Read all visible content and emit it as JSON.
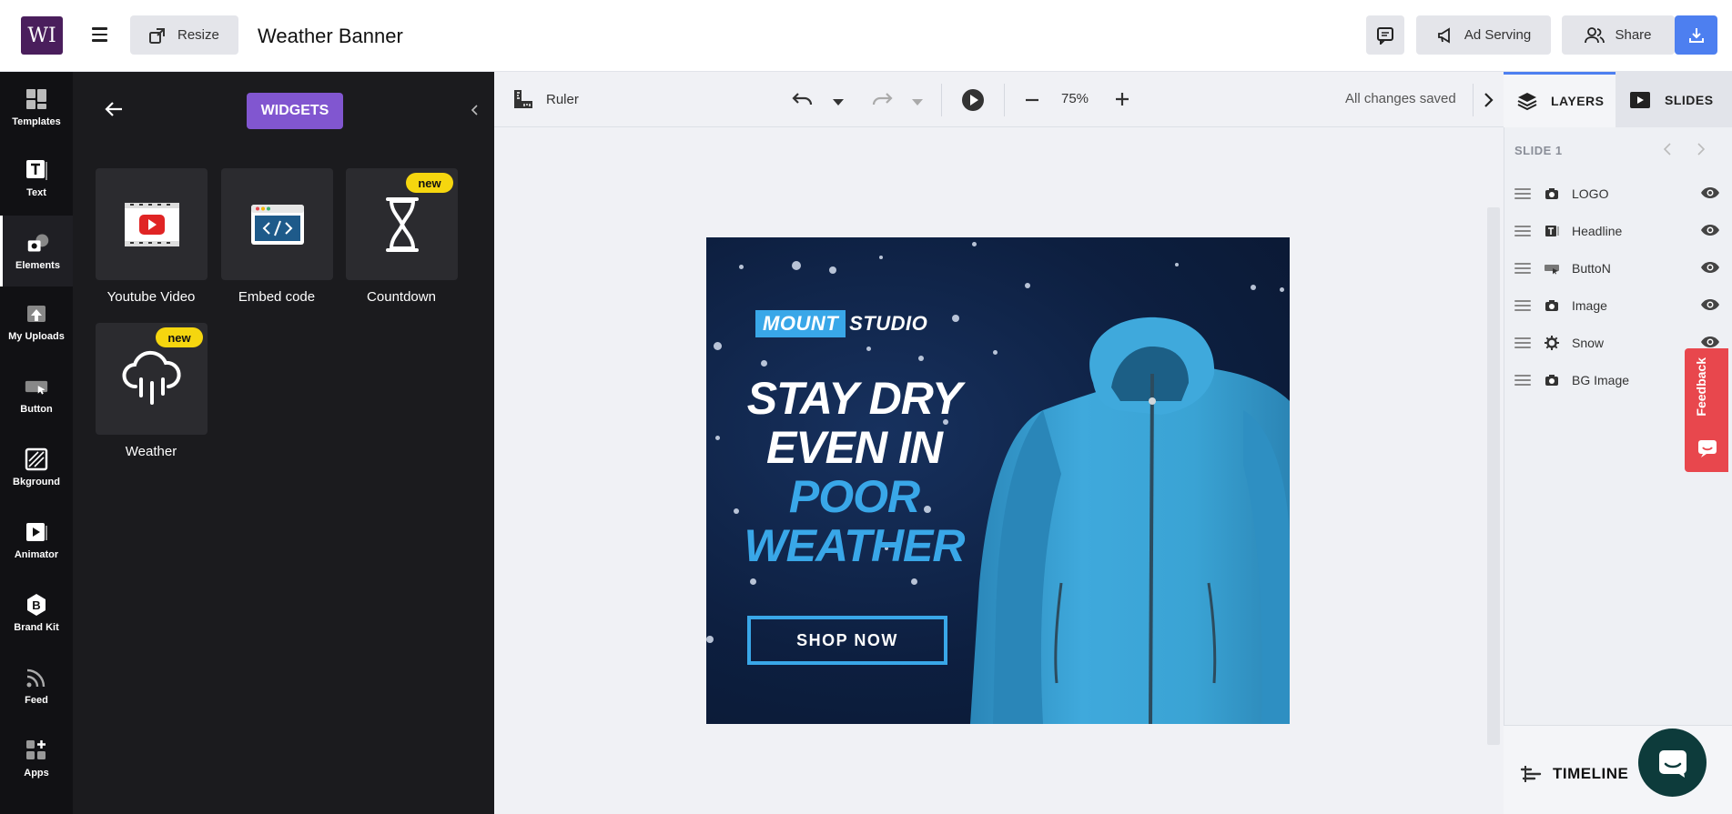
{
  "app": {
    "logo_text": "WI",
    "document_title": "Weather Banner"
  },
  "topbar": {
    "resize_label": "Resize",
    "ad_serving_label": "Ad Serving",
    "share_label": "Share"
  },
  "rail": {
    "items": [
      {
        "label": "Templates",
        "icon": "templates-icon"
      },
      {
        "label": "Text",
        "icon": "text-icon"
      },
      {
        "label": "Elements",
        "icon": "elements-icon"
      },
      {
        "label": "My Uploads",
        "icon": "upload-icon"
      },
      {
        "label": "Button",
        "icon": "button-icon"
      },
      {
        "label": "Bkground",
        "icon": "background-icon"
      },
      {
        "label": "Animator",
        "icon": "animator-icon"
      },
      {
        "label": "Brand Kit",
        "icon": "brand-kit-icon"
      },
      {
        "label": "Feed",
        "icon": "feed-icon"
      },
      {
        "label": "Apps",
        "icon": "apps-icon"
      }
    ],
    "active": "Elements"
  },
  "widgets_panel": {
    "title": "WIDGETS",
    "badge_text": "new",
    "widgets": [
      {
        "label": "Youtube Video",
        "icon": "youtube-icon",
        "is_new": false
      },
      {
        "label": "Embed code",
        "icon": "embed-code-icon",
        "is_new": false
      },
      {
        "label": "Countdown",
        "icon": "countdown-icon",
        "is_new": true
      },
      {
        "label": "Weather",
        "icon": "weather-icon",
        "is_new": true
      }
    ]
  },
  "canvas_toolbar": {
    "ruler_label": "Ruler",
    "zoom": "75%",
    "save_status": "All changes saved"
  },
  "banner": {
    "logo_part1": "MOUNT",
    "logo_part2": "STUDIO",
    "headline_line1": "STAY DRY",
    "headline_line2": "EVEN IN",
    "headline_line3": "POOR",
    "headline_line4": "WEATHER",
    "cta": "SHOP NOW",
    "colors": {
      "accent": "#39a7e8",
      "background": "#0d1f40",
      "jacket": "#3aa3d4"
    }
  },
  "right_panel": {
    "tabs": [
      {
        "label": "LAYERS",
        "active": true
      },
      {
        "label": "SLIDES",
        "active": false
      }
    ],
    "slide_label": "SLIDE 1",
    "layers": [
      {
        "name": "LOGO",
        "icon": "camera-icon",
        "visible": true
      },
      {
        "name": "Headline",
        "icon": "text-layer-icon",
        "visible": true
      },
      {
        "name": "ButtoN",
        "icon": "button-layer-icon",
        "visible": true
      },
      {
        "name": "Image",
        "icon": "camera-icon",
        "visible": true
      },
      {
        "name": "Snow",
        "icon": "gear-icon",
        "visible": true
      },
      {
        "name": "BG Image",
        "icon": "camera-icon",
        "visible": true
      }
    ],
    "feedback_label": "Feedback",
    "timeline_label": "TIMELINE"
  },
  "colors": {
    "brand_purple": "#4a1e5c",
    "widgets_pill": "#8156d0",
    "download_blue": "#4d7ff0",
    "new_badge": "#f5d60f",
    "feedback_red": "#e8474d"
  }
}
